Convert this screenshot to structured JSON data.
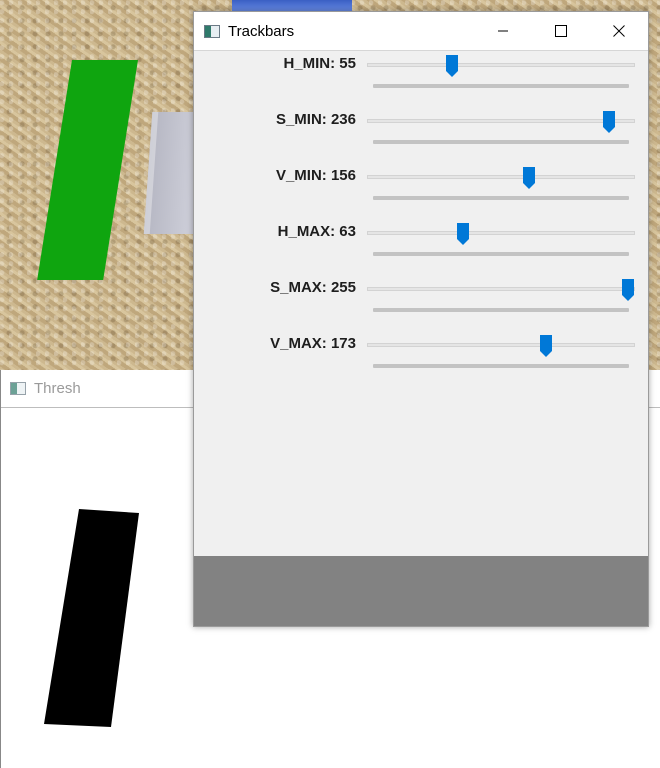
{
  "colors": {
    "accent": "#0078d7",
    "green_object": "#0fa50f"
  },
  "trackbars_window": {
    "title": "Trackbars",
    "icon": "app-window-icon",
    "controls": {
      "minimize": "minimize-icon",
      "maximize": "maximize-icon",
      "close": "close-icon"
    },
    "sliders": [
      {
        "label": "H_MIN: 55",
        "name": "H_MIN",
        "value": 55,
        "max": 179
      },
      {
        "label": "S_MIN: 236",
        "name": "S_MIN",
        "value": 236,
        "max": 255
      },
      {
        "label": "V_MIN: 156",
        "name": "V_MIN",
        "value": 156,
        "max": 255
      },
      {
        "label": "H_MAX: 63",
        "name": "H_MAX",
        "value": 63,
        "max": 179
      },
      {
        "label": "S_MAX: 255",
        "name": "S_MAX",
        "value": 255,
        "max": 255
      },
      {
        "label": "V_MAX: 173",
        "name": "V_MAX",
        "value": 173,
        "max": 255
      }
    ]
  },
  "thresh_window": {
    "title": "Thresh",
    "icon": "app-window-icon"
  }
}
